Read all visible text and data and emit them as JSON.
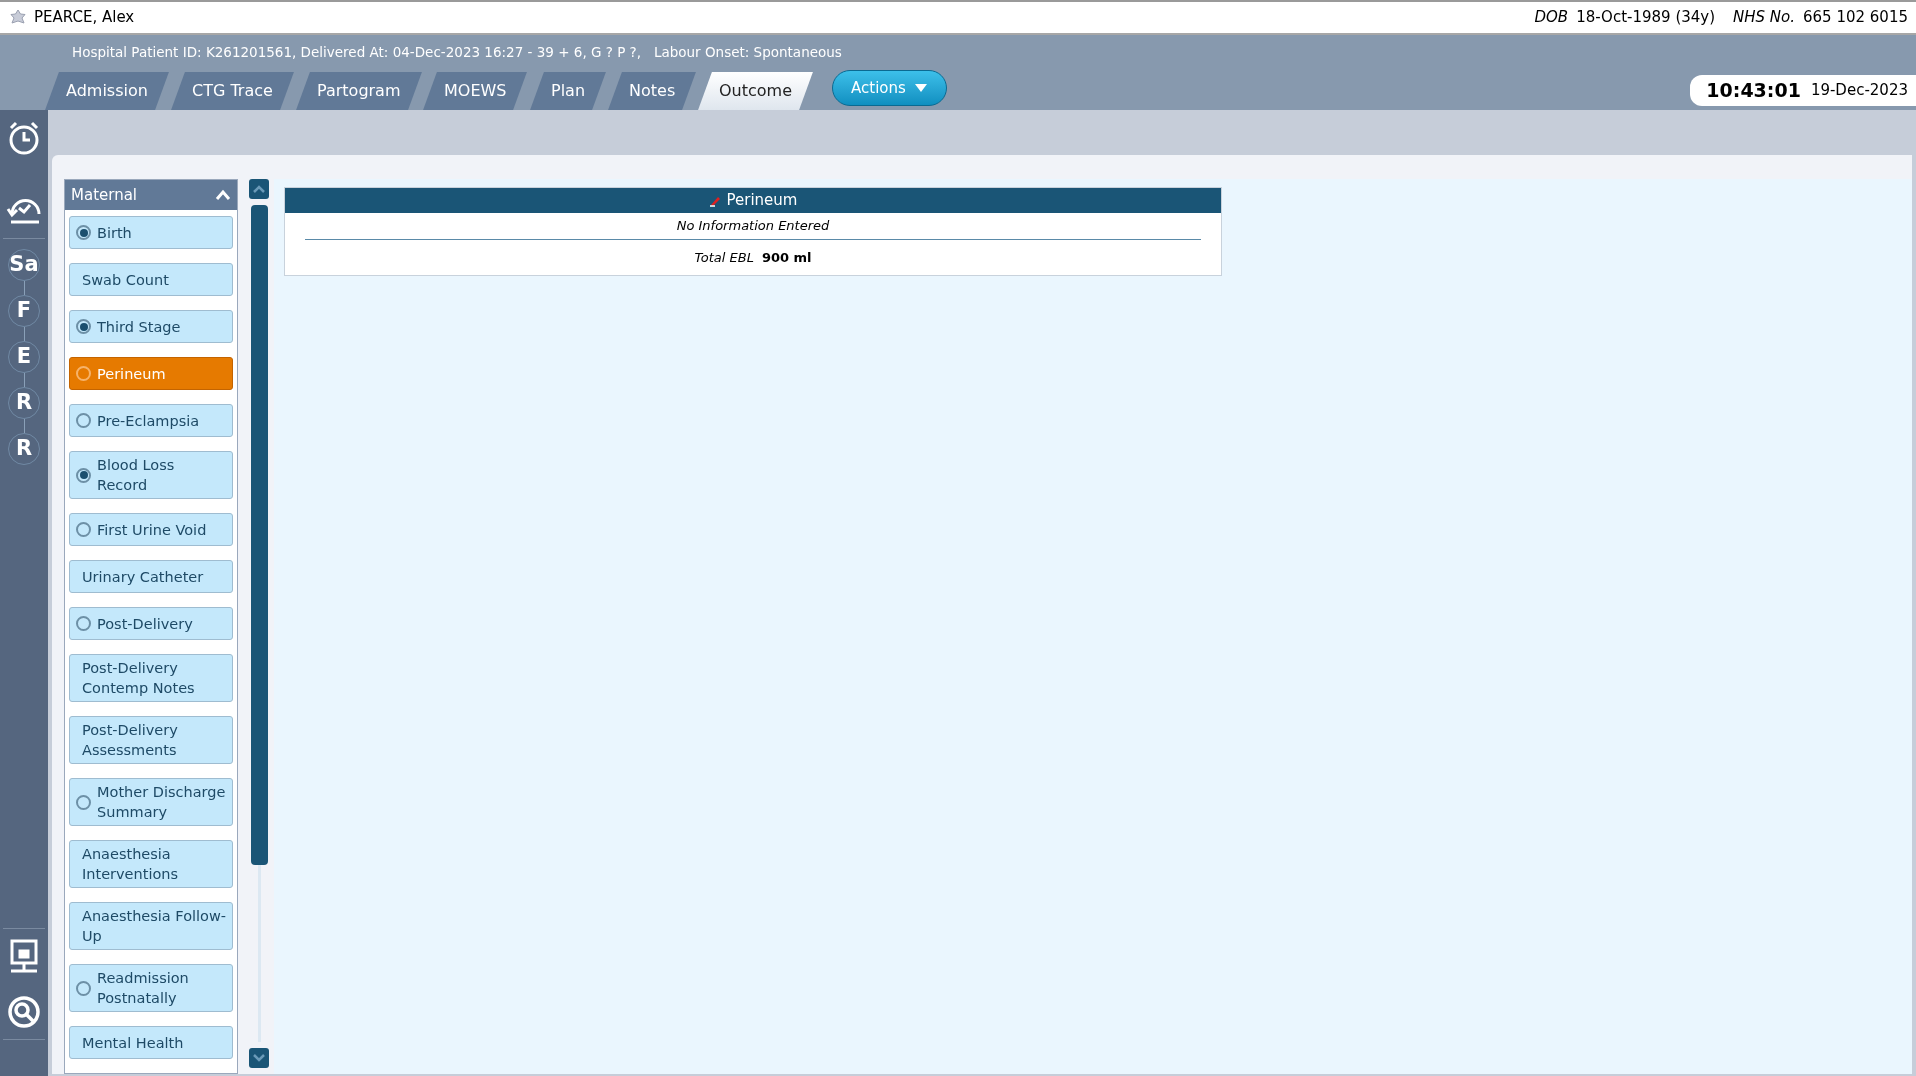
{
  "patient": {
    "name": "PEARCE, Alex",
    "dob_label": "DOB",
    "dob": "18-Oct-1989 (34y)",
    "nhs_label": "NHS No.",
    "nhs": "665 102 6015"
  },
  "summary": "Hospital Patient ID: K261201561, Delivered At: 04-Dec-2023 16:27 - 39 + 6, G ? P ?,   Labour Onset: Spontaneous",
  "tabs": [
    {
      "label": "Admission",
      "selected": false
    },
    {
      "label": "CTG Trace",
      "selected": false
    },
    {
      "label": "Partogram",
      "selected": false
    },
    {
      "label": "MOEWS",
      "selected": false
    },
    {
      "label": "Plan",
      "selected": false
    },
    {
      "label": "Notes",
      "selected": false
    },
    {
      "label": "Outcome",
      "selected": true
    }
  ],
  "actions_button": "Actions",
  "clock": {
    "time": "10:43:01",
    "date": "19-Dec-2023"
  },
  "rail_steps": [
    "Sa",
    "F",
    "E",
    "R",
    "R"
  ],
  "sidebar": {
    "title": "Maternal",
    "expanded": true,
    "items": [
      {
        "label": "Birth",
        "kind": "radio",
        "checked": true,
        "selected": false
      },
      {
        "label": "Swab Count",
        "kind": "plain",
        "selected": false
      },
      {
        "label": "Third Stage",
        "kind": "radio",
        "checked": true,
        "selected": false
      },
      {
        "label": "Perineum",
        "kind": "radio",
        "checked": false,
        "selected": true
      },
      {
        "label": "Pre-Eclampsia",
        "kind": "radio",
        "checked": false,
        "selected": false
      },
      {
        "label": "Blood Loss Record",
        "kind": "radio",
        "checked": true,
        "selected": false
      },
      {
        "label": "First Urine Void",
        "kind": "radio",
        "checked": false,
        "selected": false
      },
      {
        "label": "Urinary Catheter",
        "kind": "plain",
        "selected": false
      },
      {
        "label": "Post-Delivery",
        "kind": "radio",
        "checked": false,
        "selected": false
      },
      {
        "label": "Post-Delivery Contemp Notes",
        "kind": "plain",
        "selected": false
      },
      {
        "label": "Post-Delivery Assessments",
        "kind": "plain",
        "selected": false
      },
      {
        "label": "Mother Discharge Summary",
        "kind": "radio",
        "checked": false,
        "selected": false
      },
      {
        "label": "Anaesthesia Interventions",
        "kind": "plain",
        "selected": false
      },
      {
        "label": "Anaesthesia Follow-Up",
        "kind": "plain",
        "selected": false
      },
      {
        "label": "Readmission Postnatally",
        "kind": "radio",
        "checked": false,
        "selected": false
      },
      {
        "label": "Mental Health",
        "kind": "plain",
        "selected": false
      }
    ]
  },
  "section": {
    "title": "Perineum",
    "message": "No Information Entered",
    "ebl_label": "Total EBL",
    "ebl_value": "900 ml"
  }
}
